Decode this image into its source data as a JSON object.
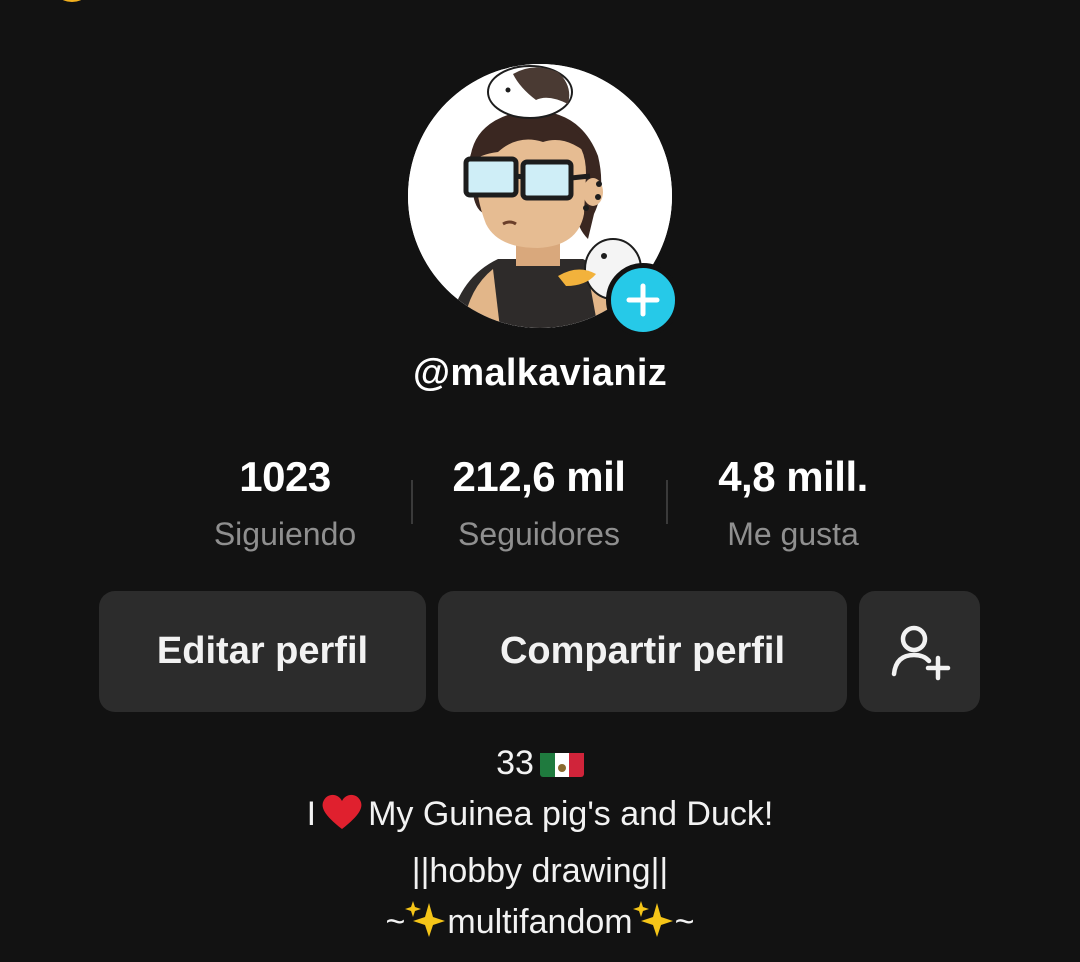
{
  "profile": {
    "username": "@malkavianiz",
    "avatar_icon": "cartoon-avatar-with-guinea-pig-and-duck",
    "add_avatar_icon": "plus-icon"
  },
  "stats": [
    {
      "value": "1023",
      "label": "Siguiendo"
    },
    {
      "value": "212,6 mil",
      "label": "Seguidores"
    },
    {
      "value": "4,8 mill.",
      "label": "Me gusta"
    }
  ],
  "actions": {
    "edit_profile": "Editar perfil",
    "share_profile": "Compartir perfil",
    "add_friend_icon": "add-user-icon"
  },
  "bio": {
    "line1_text": "33",
    "line1_flag": "mexico-flag",
    "line2_prefix": "I",
    "line2_heart": "red-heart",
    "line2_suffix": "My Guinea pig's and Duck!",
    "line3": "||hobby drawing||",
    "line4_prefix": "~",
    "line4_middle": "multifandom",
    "line4_suffix": "~"
  },
  "colors": {
    "background": "#121212",
    "button_bg": "#2c2c2c",
    "secondary_text": "#8f8f8f",
    "accent": "#26c9e8"
  }
}
